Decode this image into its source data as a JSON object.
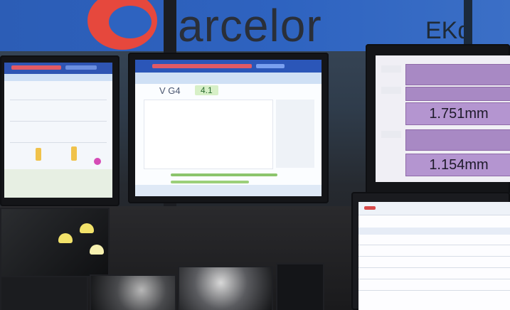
{
  "banner": {
    "brand_text": "arcelor",
    "brand_partial": "EKd"
  },
  "center_monitor": {
    "label": "V G4",
    "value": "4.1"
  },
  "right_monitor": {
    "readout_1": "1.751mm",
    "readout_2": "1.154mm"
  },
  "colors": {
    "banner_blue": "#2e63c0",
    "logo_red": "#e6483d",
    "readout_purple": "#b495d0"
  }
}
